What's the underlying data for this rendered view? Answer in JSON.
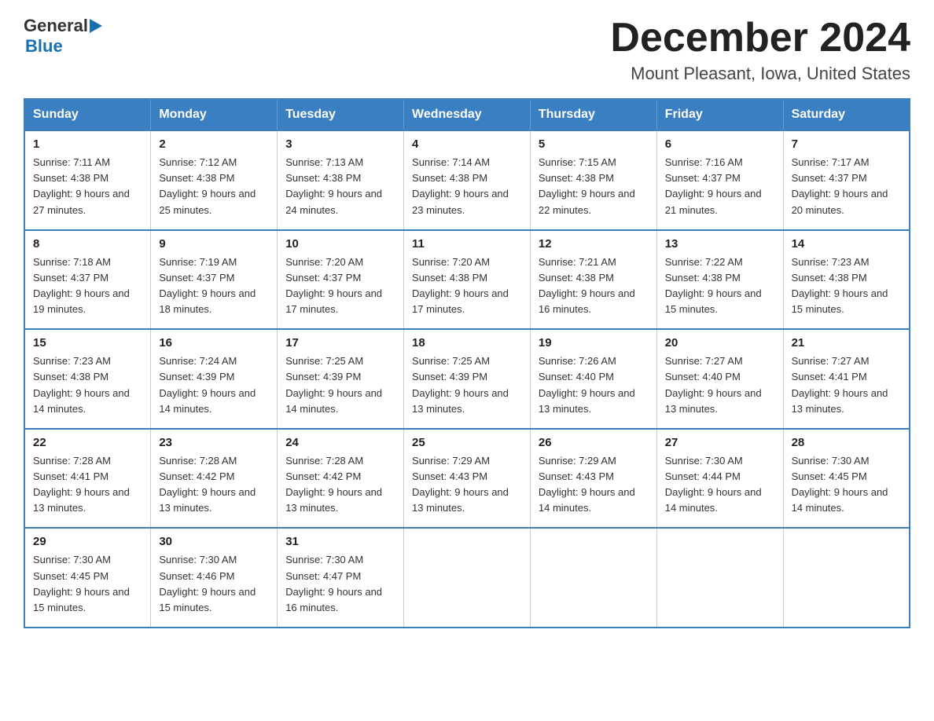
{
  "logo": {
    "general": "General",
    "blue": "Blue",
    "arrow": "▶"
  },
  "header": {
    "title": "December 2024",
    "subtitle": "Mount Pleasant, Iowa, United States"
  },
  "weekdays": [
    "Sunday",
    "Monday",
    "Tuesday",
    "Wednesday",
    "Thursday",
    "Friday",
    "Saturday"
  ],
  "weeks": [
    [
      {
        "day": "1",
        "sunrise": "7:11 AM",
        "sunset": "4:38 PM",
        "daylight": "9 hours and 27 minutes."
      },
      {
        "day": "2",
        "sunrise": "7:12 AM",
        "sunset": "4:38 PM",
        "daylight": "9 hours and 25 minutes."
      },
      {
        "day": "3",
        "sunrise": "7:13 AM",
        "sunset": "4:38 PM",
        "daylight": "9 hours and 24 minutes."
      },
      {
        "day": "4",
        "sunrise": "7:14 AM",
        "sunset": "4:38 PM",
        "daylight": "9 hours and 23 minutes."
      },
      {
        "day": "5",
        "sunrise": "7:15 AM",
        "sunset": "4:38 PM",
        "daylight": "9 hours and 22 minutes."
      },
      {
        "day": "6",
        "sunrise": "7:16 AM",
        "sunset": "4:37 PM",
        "daylight": "9 hours and 21 minutes."
      },
      {
        "day": "7",
        "sunrise": "7:17 AM",
        "sunset": "4:37 PM",
        "daylight": "9 hours and 20 minutes."
      }
    ],
    [
      {
        "day": "8",
        "sunrise": "7:18 AM",
        "sunset": "4:37 PM",
        "daylight": "9 hours and 19 minutes."
      },
      {
        "day": "9",
        "sunrise": "7:19 AM",
        "sunset": "4:37 PM",
        "daylight": "9 hours and 18 minutes."
      },
      {
        "day": "10",
        "sunrise": "7:20 AM",
        "sunset": "4:37 PM",
        "daylight": "9 hours and 17 minutes."
      },
      {
        "day": "11",
        "sunrise": "7:20 AM",
        "sunset": "4:38 PM",
        "daylight": "9 hours and 17 minutes."
      },
      {
        "day": "12",
        "sunrise": "7:21 AM",
        "sunset": "4:38 PM",
        "daylight": "9 hours and 16 minutes."
      },
      {
        "day": "13",
        "sunrise": "7:22 AM",
        "sunset": "4:38 PM",
        "daylight": "9 hours and 15 minutes."
      },
      {
        "day": "14",
        "sunrise": "7:23 AM",
        "sunset": "4:38 PM",
        "daylight": "9 hours and 15 minutes."
      }
    ],
    [
      {
        "day": "15",
        "sunrise": "7:23 AM",
        "sunset": "4:38 PM",
        "daylight": "9 hours and 14 minutes."
      },
      {
        "day": "16",
        "sunrise": "7:24 AM",
        "sunset": "4:39 PM",
        "daylight": "9 hours and 14 minutes."
      },
      {
        "day": "17",
        "sunrise": "7:25 AM",
        "sunset": "4:39 PM",
        "daylight": "9 hours and 14 minutes."
      },
      {
        "day": "18",
        "sunrise": "7:25 AM",
        "sunset": "4:39 PM",
        "daylight": "9 hours and 13 minutes."
      },
      {
        "day": "19",
        "sunrise": "7:26 AM",
        "sunset": "4:40 PM",
        "daylight": "9 hours and 13 minutes."
      },
      {
        "day": "20",
        "sunrise": "7:27 AM",
        "sunset": "4:40 PM",
        "daylight": "9 hours and 13 minutes."
      },
      {
        "day": "21",
        "sunrise": "7:27 AM",
        "sunset": "4:41 PM",
        "daylight": "9 hours and 13 minutes."
      }
    ],
    [
      {
        "day": "22",
        "sunrise": "7:28 AM",
        "sunset": "4:41 PM",
        "daylight": "9 hours and 13 minutes."
      },
      {
        "day": "23",
        "sunrise": "7:28 AM",
        "sunset": "4:42 PM",
        "daylight": "9 hours and 13 minutes."
      },
      {
        "day": "24",
        "sunrise": "7:28 AM",
        "sunset": "4:42 PM",
        "daylight": "9 hours and 13 minutes."
      },
      {
        "day": "25",
        "sunrise": "7:29 AM",
        "sunset": "4:43 PM",
        "daylight": "9 hours and 13 minutes."
      },
      {
        "day": "26",
        "sunrise": "7:29 AM",
        "sunset": "4:43 PM",
        "daylight": "9 hours and 14 minutes."
      },
      {
        "day": "27",
        "sunrise": "7:30 AM",
        "sunset": "4:44 PM",
        "daylight": "9 hours and 14 minutes."
      },
      {
        "day": "28",
        "sunrise": "7:30 AM",
        "sunset": "4:45 PM",
        "daylight": "9 hours and 14 minutes."
      }
    ],
    [
      {
        "day": "29",
        "sunrise": "7:30 AM",
        "sunset": "4:45 PM",
        "daylight": "9 hours and 15 minutes."
      },
      {
        "day": "30",
        "sunrise": "7:30 AM",
        "sunset": "4:46 PM",
        "daylight": "9 hours and 15 minutes."
      },
      {
        "day": "31",
        "sunrise": "7:30 AM",
        "sunset": "4:47 PM",
        "daylight": "9 hours and 16 minutes."
      },
      null,
      null,
      null,
      null
    ]
  ],
  "labels": {
    "sunrise_prefix": "Sunrise: ",
    "sunset_prefix": "Sunset: ",
    "daylight_prefix": "Daylight: "
  }
}
